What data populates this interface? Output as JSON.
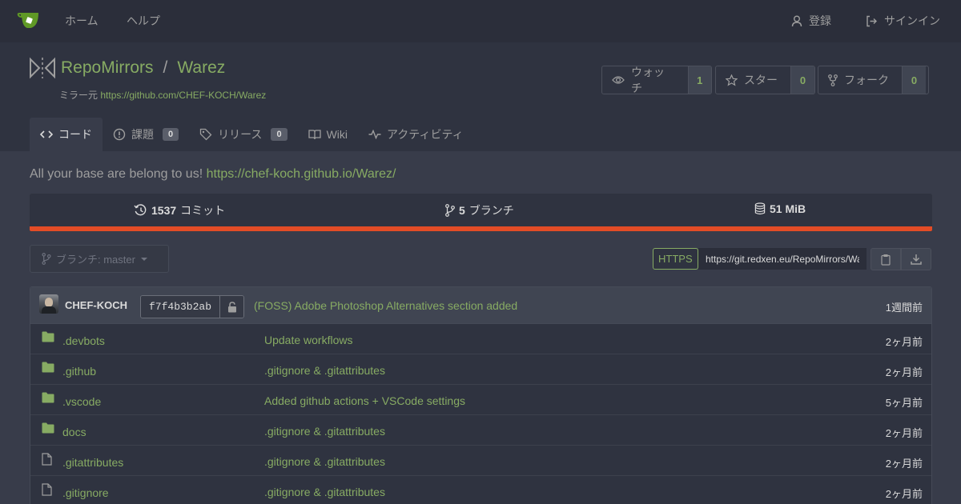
{
  "nav": {
    "home": "ホーム",
    "help": "ヘルプ",
    "register": "登録",
    "signin": "サインイン"
  },
  "repo": {
    "owner": "RepoMirrors",
    "separator": "/",
    "name": "Warez",
    "mirror_label": "ミラー元",
    "mirror_url": "https://github.com/CHEF-KOCH/Warez"
  },
  "actions": {
    "watch_label": "ウォッチ",
    "watch_count": "1",
    "star_label": "スター",
    "star_count": "0",
    "fork_label": "フォーク",
    "fork_count": "0"
  },
  "tabs": {
    "code": "コード",
    "issues": "課題",
    "issues_count": "0",
    "releases": "リリース",
    "releases_count": "0",
    "wiki": "Wiki",
    "activity": "アクティビティ"
  },
  "description": {
    "text": "All your base are belong to us!",
    "link": "https://chef-koch.github.io/Warez/"
  },
  "stats": {
    "commits_count": "1537",
    "commits_label": "コミット",
    "branches_count": "5",
    "branches_label": "ブランチ",
    "size": "51 MiB"
  },
  "branch": {
    "label": "ブランチ: master"
  },
  "clone": {
    "protocol": "HTTPS",
    "url": "https://git.redxen.eu/RepoMirrors/Warez.git"
  },
  "latest_commit": {
    "author": "CHEF-KOCH",
    "sha": "f7f4b3b2ab",
    "message": "(FOSS) Adobe Photoshop Alternatives section added",
    "time": "1週間前"
  },
  "files": [
    {
      "type": "folder",
      "name": ".devbots",
      "message": "Update workflows",
      "time": "2ヶ月前"
    },
    {
      "type": "folder",
      "name": ".github",
      "message": ".gitignore & .gitattributes",
      "time": "2ヶ月前"
    },
    {
      "type": "folder",
      "name": ".vscode",
      "message": "Added github actions + VSCode settings",
      "time": "5ヶ月前"
    },
    {
      "type": "folder",
      "name": "docs",
      "message": ".gitignore & .gitattributes",
      "time": "2ヶ月前"
    },
    {
      "type": "file",
      "name": ".gitattributes",
      "message": ".gitignore & .gitattributes",
      "time": "2ヶ月前"
    },
    {
      "type": "file",
      "name": ".gitignore",
      "message": ".gitignore & .gitattributes",
      "time": "2ヶ月前"
    }
  ],
  "colors": {
    "accent": "#87ab63",
    "background": "#383c4a",
    "header": "#2b2e3a",
    "language_bar": "#e34c26"
  }
}
